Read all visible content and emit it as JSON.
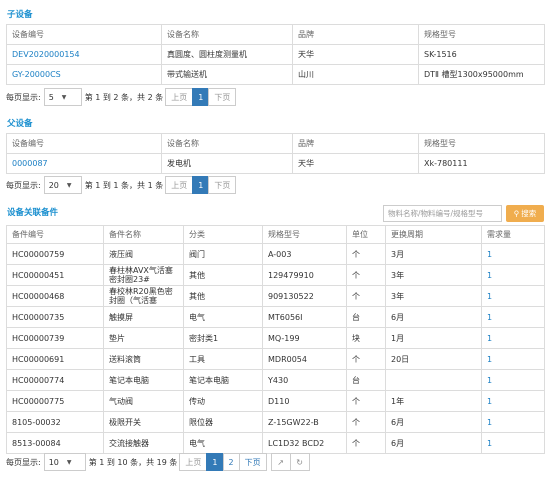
{
  "child": {
    "title": "子设备",
    "headers": [
      "设备编号",
      "设备名称",
      "品牌",
      "规格型号"
    ],
    "rows": [
      [
        "DEV2020000154",
        "真圆度、圆柱度测量机",
        "天华",
        "SK-1516"
      ],
      [
        "GY-20000CS",
        "带式输送机",
        "山川",
        "DTⅡ 槽型1300x95000mm"
      ]
    ],
    "pager": {
      "label_pre": "每页显示:",
      "size": "5",
      "info": "第 1 到 2 条，共 2 条",
      "prev": "上页",
      "page": "1",
      "next": "下页"
    }
  },
  "parent": {
    "title": "父设备",
    "headers": [
      "设备编号",
      "设备名称",
      "品牌",
      "规格型号"
    ],
    "rows": [
      [
        "0000087",
        "发电机",
        "天华",
        "Xk-780111"
      ]
    ],
    "pager": {
      "label_pre": "每页显示:",
      "size": "20",
      "info": "第 1 到 1 条，共 1 条",
      "prev": "上页",
      "page": "1",
      "next": "下页"
    }
  },
  "parts": {
    "title": "设备关联备件",
    "search_placeholder": "物料名称/物料编号/规格型号",
    "search_button": "搜索",
    "headers": [
      "备件编号",
      "备件名称",
      "分类",
      "规格型号",
      "单位",
      "更换周期",
      "需求量"
    ],
    "rows": [
      [
        "HC00000759",
        "液压阀",
        "阀门",
        "A-003",
        "个",
        "3月",
        "1"
      ],
      [
        "HC00000451",
        "春柱林AVX气活塞密封圈23#",
        "其他",
        "129479910",
        "个",
        "3年",
        "1"
      ],
      [
        "HC00000468",
        "春校林R20黑色密封圈（气活塞",
        "其他",
        "909130522",
        "个",
        "3年",
        "1"
      ],
      [
        "HC00000735",
        "触摸屏",
        "电气",
        "MT6056I",
        "台",
        "6月",
        "1"
      ],
      [
        "HC00000739",
        "垫片",
        "密封类1",
        "MQ-199",
        "块",
        "1月",
        "1"
      ],
      [
        "HC00000691",
        "送料滚筒",
        "工具",
        "MDR0054",
        "个",
        "20日",
        "1"
      ],
      [
        "HC00000774",
        "笔记本电脑",
        "笔记本电脑",
        "Y430",
        "台",
        "",
        "1"
      ],
      [
        "HC00000775",
        "气动阀",
        "传动",
        "D110",
        "个",
        "1年",
        "1"
      ],
      [
        "8105-00032",
        "极限开关",
        "限位器",
        "Z-15GW22-B",
        "个",
        "6月",
        "1"
      ],
      [
        "8513-00084",
        "交流接触器",
        "电气",
        "LC1D32 BCD2",
        "个",
        "6月",
        "1"
      ]
    ],
    "pager": {
      "label_pre": "每页显示:",
      "size": "10",
      "info": "第 1 到 10 条，共 19 条",
      "prev": "上页",
      "page1": "1",
      "page2": "2",
      "next": "下页"
    }
  }
}
